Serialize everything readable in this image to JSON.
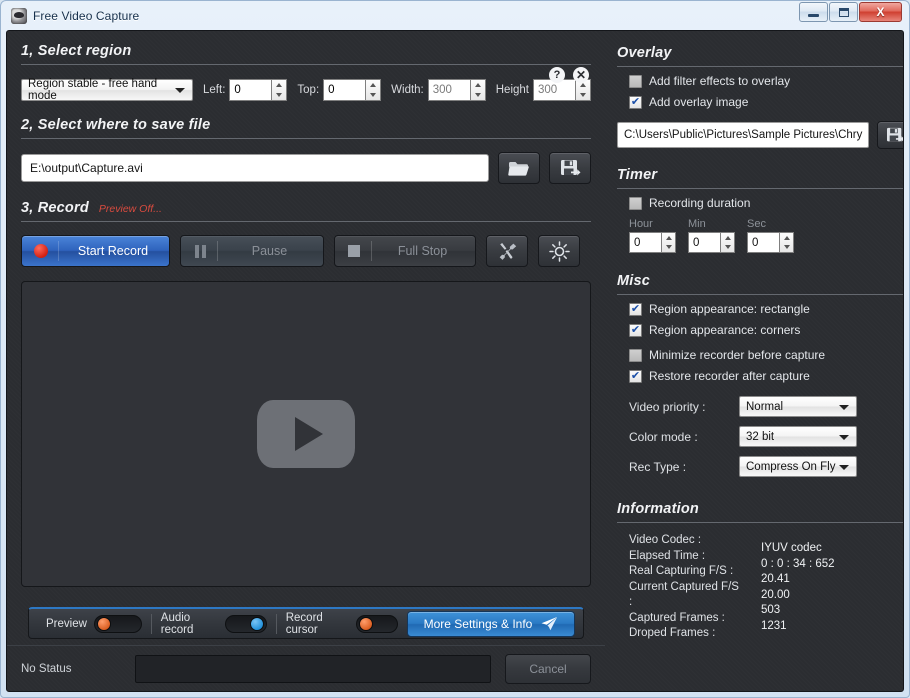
{
  "window": {
    "title": "Free Video Capture",
    "icon": "app-icon",
    "minimize_label": "Minimize",
    "maximize_label": "Maximize",
    "close_label": "X"
  },
  "left": {
    "step1": {
      "title": "1, Select region",
      "mode_value": "Region stable - free hand mode",
      "left_label": "Left:",
      "left_value": "0",
      "top_label": "Top:",
      "top_value": "0",
      "width_label": "Width:",
      "width_value": "300",
      "height_label": "Height",
      "height_value": "300",
      "help_icon": "?",
      "close_icon": "✕"
    },
    "step2": {
      "title": "2, Select where to save file",
      "path_value": "E:\\output\\Capture.avi",
      "browse_icon": "folder-icon",
      "save_icon": "save-as-icon"
    },
    "step3": {
      "title": "3, Record",
      "preview_status": "Preview Off...",
      "start_label": "Start Record",
      "pause_label": "Pause",
      "stop_label": "Full Stop",
      "tools_icon": "tools-icon",
      "brightness_icon": "brightness-icon"
    },
    "toolbar": {
      "preview_label": "Preview",
      "preview_state": "off",
      "audio_label": "Audio record",
      "audio_state": "on",
      "cursor_label": "Record cursor",
      "cursor_state": "off",
      "more_label": "More Settings & Info"
    },
    "status": {
      "status_text": "No Status",
      "cancel_label": "Cancel"
    }
  },
  "right": {
    "overlay": {
      "title": "Overlay",
      "filter_label": "Add filter effects to overlay",
      "filter_checked": false,
      "image_label": "Add overlay image",
      "image_checked": true,
      "image_path": "C:\\Users\\Public\\Pictures\\Sample Pictures\\Chry",
      "save_icon": "save-as-icon"
    },
    "timer": {
      "title": "Timer",
      "duration_label": "Recording duration",
      "duration_checked": false,
      "hour_label": "Hour",
      "hour_value": "0",
      "min_label": "Min",
      "min_value": "0",
      "sec_label": "Sec",
      "sec_value": "0"
    },
    "misc": {
      "title": "Misc",
      "rect_label": "Region appearance: rectangle",
      "rect_checked": true,
      "corners_label": "Region appearance: corners",
      "corners_checked": true,
      "minimize_label": "Minimize recorder before capture",
      "minimize_checked": false,
      "restore_label": "Restore recorder after capture",
      "restore_checked": true,
      "priority_label": "Video priority :",
      "priority_value": "Normal",
      "color_label": "Color mode :",
      "color_value": "32 bit",
      "rectype_label": "Rec Type :",
      "rectype_value": "Compress On Fly"
    },
    "information": {
      "title": "Information",
      "labels": [
        "Video Codec :",
        "Elapsed Time :",
        "Real Capturing F/S :",
        "Current Captured F/S :",
        "Captured Frames :",
        "Droped Frames :"
      ],
      "values": [
        "IYUV codec",
        "0 : 0 : 34 : 652",
        "20.41",
        "20.00",
        "503",
        "1231"
      ]
    }
  },
  "colors": {
    "accent_blue": "#2d78c4",
    "record_red": "#d32012",
    "panel_bg": "#2b2d31",
    "preview_off": "#d94b3f"
  }
}
